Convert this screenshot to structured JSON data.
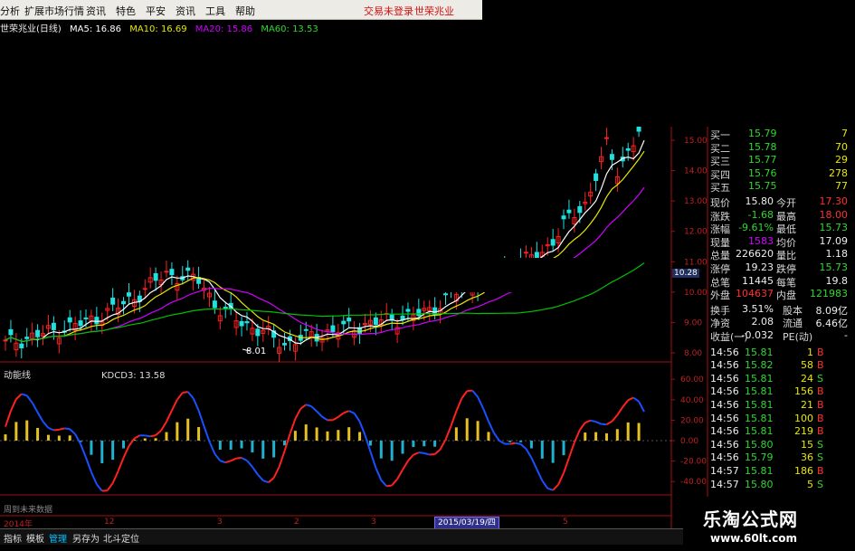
{
  "menu": {
    "items": [
      "分析",
      "扩展市场行情",
      "资讯",
      "特色",
      "平安",
      "资讯",
      "工具",
      "帮助"
    ],
    "trade_status": "交易未登录",
    "stock_name": "世荣兆业"
  },
  "ma_strip": {
    "title": "世荣兆业(日线)",
    "ma5": "MA5: 16.86",
    "ma10": "MA10: 16.69",
    "ma20": "MA20: 15.86",
    "ma60": "MA60: 13.53"
  },
  "colors": {
    "ma5": "#ffffff",
    "ma10": "#e8e800",
    "ma20": "#d000ff",
    "ma60": "#00c000",
    "up": "#ff2020",
    "down": "#20e0e0",
    "kdcd_up": "#ff2020",
    "kdcd_down": "#1a50ff"
  },
  "price_chart": {
    "axis_labels": [
      "15.00",
      "14.00",
      "13.00",
      "12.00",
      "11.00",
      "10.00",
      "9.00",
      "8.00"
    ],
    "low_marker": "8.01",
    "current_price_tag": "10.28"
  },
  "indicator": {
    "name": "动能线",
    "value_label": "KDCD3: 13.58",
    "axis_labels": [
      "60.00",
      "40.00",
      "20.00",
      "0.00",
      "-20.00",
      "-40.00"
    ]
  },
  "time_axis": {
    "start": "2014年",
    "ticks": [
      "12",
      "3",
      "2",
      "3",
      "5"
    ],
    "cursor_date": "2015/03/19/四"
  },
  "note": "周到未来数据",
  "quote_panel": {
    "bids": [
      {
        "label": "买一",
        "price": "15.79",
        "vol": "7"
      },
      {
        "label": "买二",
        "price": "15.78",
        "vol": "70"
      },
      {
        "label": "买三",
        "price": "15.77",
        "vol": "29"
      },
      {
        "label": "买四",
        "price": "15.76",
        "vol": "278"
      },
      {
        "label": "买五",
        "price": "15.75",
        "vol": "77"
      }
    ],
    "stats": [
      {
        "l1": "现价",
        "v1": "15.80",
        "l2": "今开",
        "v2": "17.30"
      },
      {
        "l1": "涨跌",
        "v1": "-1.68",
        "l2": "最高",
        "v2": "18.00"
      },
      {
        "l1": "涨幅",
        "v1": "-9.61%",
        "l2": "最低",
        "v2": "15.73"
      },
      {
        "l1": "现量",
        "v1": "1583",
        "l2": "均价",
        "v2": "17.09"
      },
      {
        "l1": "总量",
        "v1": "226620",
        "l2": "量比",
        "v2": "1.18"
      },
      {
        "l1": "涨停",
        "v1": "19.23",
        "l2": "跌停",
        "v2": "15.73"
      },
      {
        "l1": "总笔",
        "v1": "11445",
        "l2": "每笔",
        "v2": "19.8"
      },
      {
        "l1": "外盘",
        "v1": "104637",
        "l2": "内盘",
        "v2": "121983"
      }
    ],
    "fin": [
      {
        "l1": "换手",
        "v1": "3.51%",
        "l2": "股本",
        "v2": "8.09亿"
      },
      {
        "l1": "净资",
        "v1": "2.08",
        "l2": "流通",
        "v2": "6.46亿"
      },
      {
        "l1": "收益(一)",
        "v1": "-0.032",
        "l2": "PE(动)",
        "v2": "-"
      }
    ],
    "ticks": [
      {
        "time": "14:56",
        "price": "15.81",
        "vol": "1",
        "side": "B"
      },
      {
        "time": "14:56",
        "price": "15.82",
        "vol": "58",
        "side": "B"
      },
      {
        "time": "14:56",
        "price": "15.81",
        "vol": "24",
        "side": "S"
      },
      {
        "time": "14:56",
        "price": "15.81",
        "vol": "156",
        "side": "B"
      },
      {
        "time": "14:56",
        "price": "15.81",
        "vol": "21",
        "side": "B"
      },
      {
        "time": "14:56",
        "price": "15.81",
        "vol": "100",
        "side": "B"
      },
      {
        "time": "14:56",
        "price": "15.81",
        "vol": "219",
        "side": "B"
      },
      {
        "time": "14:56",
        "price": "15.80",
        "vol": "15",
        "side": "S"
      },
      {
        "time": "14:56",
        "price": "15.79",
        "vol": "36",
        "side": "S"
      },
      {
        "time": "14:57",
        "price": "15.81",
        "vol": "186",
        "side": "B"
      },
      {
        "time": "14:57",
        "price": "15.80",
        "vol": "5",
        "side": "S"
      }
    ]
  },
  "tabs": [
    "指标",
    "模板",
    "管理",
    "另存为",
    "北斗定位"
  ],
  "watermark": {
    "cn": "乐淘公式网",
    "url": "www.60lt.com"
  }
}
